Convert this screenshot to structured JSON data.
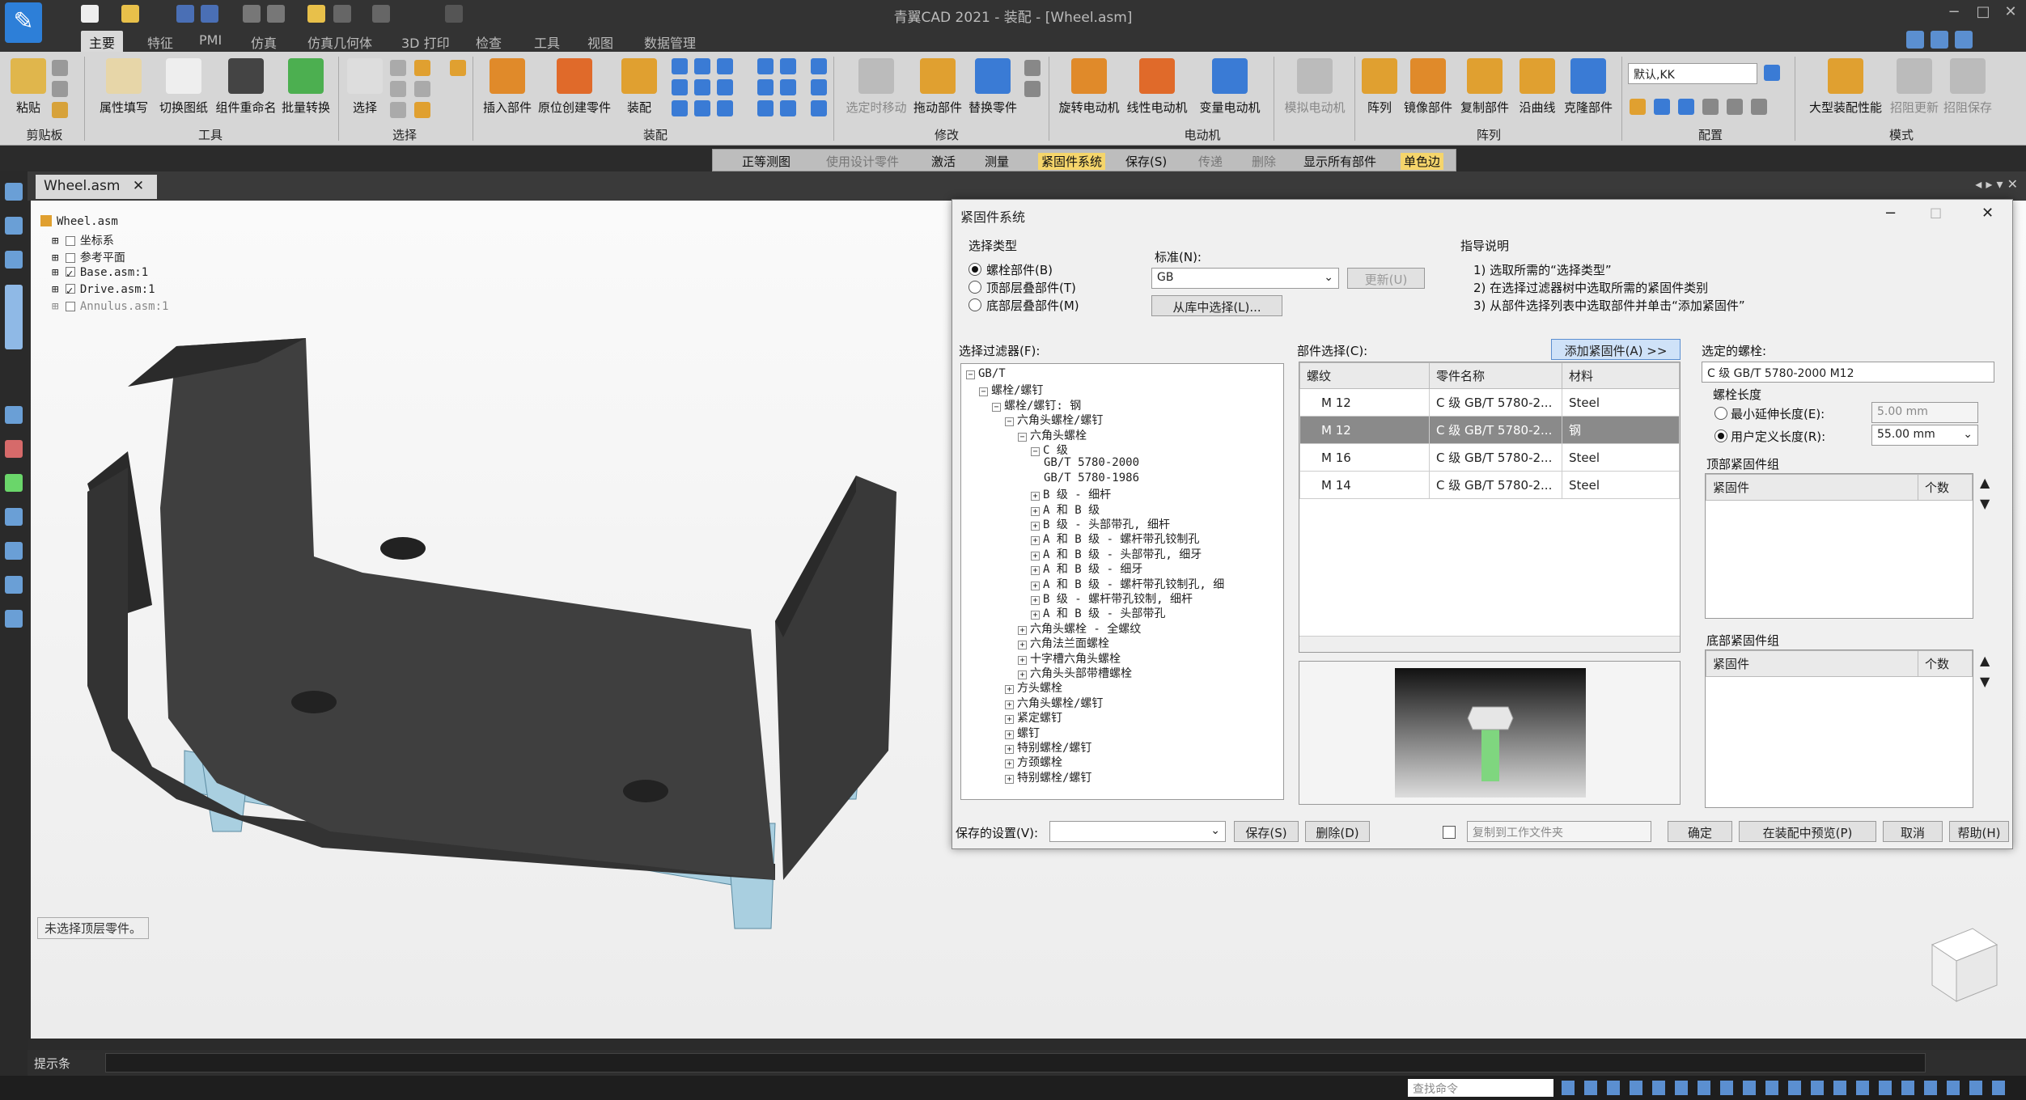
{
  "window": {
    "title": "青翼CAD 2021 - 装配 - [Wheel.asm]"
  },
  "menu_tabs": [
    "主要",
    "特征",
    "PMI",
    "仿真",
    "仿真几何体",
    "3D 打印",
    "检查",
    "工具",
    "视图",
    "数据管理"
  ],
  "active_tab": "主要",
  "ribbon": {
    "buttons": [
      "粘贴",
      "属性填写",
      "切换图纸",
      "组件重命名",
      "批量转换",
      "选择",
      "插入部件",
      "原位创建零件",
      "装配",
      "选定时移动",
      "拖动部件",
      "替换零件",
      "旋转电动机",
      "线性电动机",
      "变量电动机",
      "模拟电动机",
      "阵列",
      "镜像部件",
      "复制部件",
      "沿曲线",
      "克隆部件",
      "大型装配性能",
      "招阻更新",
      "招阻保存"
    ],
    "groups": [
      "剪贴板",
      "工具",
      "选择",
      "装配",
      "修改",
      "电动机",
      "阵列",
      "配置",
      "模式"
    ],
    "config_value": "默认,KK"
  },
  "quick_toolbar": {
    "items": [
      "正等测图",
      "使用设计零件",
      "激活",
      "测量",
      "紧固件系统",
      "保存(S)",
      "传递",
      "删除",
      "显示所有部件",
      "单色边"
    ]
  },
  "doc_tab": "Wheel.asm",
  "assembly_tree": [
    {
      "label": "Wheel.asm",
      "checked": null
    },
    {
      "label": "坐标系",
      "checked": false
    },
    {
      "label": "参考平面",
      "checked": false
    },
    {
      "label": "Base.asm:1",
      "checked": true
    },
    {
      "label": "Drive.asm:1",
      "checked": true
    },
    {
      "label": "Annulus.asm:1",
      "checked": false
    }
  ],
  "viewport_status": "未选择顶层零件。",
  "dialog": {
    "title": "紧固件系统",
    "select_type": {
      "label": "选择类型",
      "options": [
        "螺栓部件(B)",
        "顶部层叠部件(T)",
        "底部层叠部件(M)"
      ],
      "selected": 0
    },
    "standard": {
      "label": "标准(N):",
      "value": "GB",
      "update_button": "更新(U)",
      "library_button": "从库中选择(L)..."
    },
    "guide": {
      "title": "指导说明",
      "steps": [
        "1) 选取所需的“选择类型”",
        "2) 在选择过滤器树中选取所需的紧固件类别",
        "3) 从部件选择列表中选取部件并单击“添加紧固件”"
      ]
    },
    "filter": {
      "label": "选择过滤器(F):",
      "tree": [
        {
          "d": 0,
          "pm": "−",
          "t": "GB/T"
        },
        {
          "d": 1,
          "pm": "−",
          "t": "螺栓/螺钉"
        },
        {
          "d": 2,
          "pm": "−",
          "t": "螺栓/螺钉: 钢"
        },
        {
          "d": 3,
          "pm": "−",
          "t": "六角头螺栓/螺钉"
        },
        {
          "d": 4,
          "pm": "−",
          "t": "六角头螺栓"
        },
        {
          "d": 5,
          "pm": "−",
          "t": "C 级"
        },
        {
          "d": 6,
          "pm": "",
          "t": "GB/T 5780-2000"
        },
        {
          "d": 6,
          "pm": "",
          "t": "GB/T 5780-1986"
        },
        {
          "d": 5,
          "pm": "+",
          "t": "B 级 - 细杆"
        },
        {
          "d": 5,
          "pm": "+",
          "t": "A 和 B 级"
        },
        {
          "d": 5,
          "pm": "+",
          "t": "B 级 - 头部带孔, 细杆"
        },
        {
          "d": 5,
          "pm": "+",
          "t": "A 和 B 级 - 螺杆带孔铰制孔"
        },
        {
          "d": 5,
          "pm": "+",
          "t": "A 和 B 级 - 头部带孔, 细牙"
        },
        {
          "d": 5,
          "pm": "+",
          "t": "A 和 B 级 - 细牙"
        },
        {
          "d": 5,
          "pm": "+",
          "t": "A 和 B 级 - 螺杆带孔铰制孔, 细"
        },
        {
          "d": 5,
          "pm": "+",
          "t": "B 级 - 螺杆带孔铰制, 细杆"
        },
        {
          "d": 5,
          "pm": "+",
          "t": "A 和 B 级 - 头部带孔"
        },
        {
          "d": 4,
          "pm": "+",
          "t": "六角头螺栓 - 全螺纹"
        },
        {
          "d": 4,
          "pm": "+",
          "t": "六角法兰面螺栓"
        },
        {
          "d": 4,
          "pm": "+",
          "t": "十字槽六角头螺栓"
        },
        {
          "d": 4,
          "pm": "+",
          "t": "六角头头部带槽螺栓"
        },
        {
          "d": 3,
          "pm": "+",
          "t": "方头螺栓"
        },
        {
          "d": 3,
          "pm": "+",
          "t": "六角头螺栓/螺钉"
        },
        {
          "d": 3,
          "pm": "+",
          "t": "紧定螺钉"
        },
        {
          "d": 3,
          "pm": "+",
          "t": "螺钉"
        },
        {
          "d": 3,
          "pm": "+",
          "t": "特别螺栓/螺钉"
        },
        {
          "d": 3,
          "pm": "+",
          "t": "方颈螺栓"
        },
        {
          "d": 3,
          "pm": "+",
          "t": "特别螺栓/螺钉"
        }
      ]
    },
    "part_select": {
      "label": "部件选择(C):",
      "add_button": "添加紧固件(A) >>",
      "headers": [
        "螺纹",
        "零件名称",
        "材料"
      ],
      "rows": [
        [
          "M 12",
          "C 级 GB/T 5780-2...",
          "Steel"
        ],
        [
          "M 12",
          "C 级 GB/T 5780-2...",
          "钢"
        ],
        [
          "M 16",
          "C 级 GB/T 5780-2...",
          "Steel"
        ],
        [
          "M 14",
          "C 级 GB/T 5780-2...",
          "Steel"
        ]
      ],
      "selected_row": 1
    },
    "selected_bolt": {
      "label": "选定的螺栓:",
      "value": "C 级 GB/T 5780-2000 M12"
    },
    "bolt_length": {
      "label": "螺栓长度",
      "min_label": "最小延伸长度(E):",
      "min_value": "5.00 mm",
      "user_label": "用户定义长度(R):",
      "user_value": "55.00 mm",
      "selected": 1
    },
    "top_group": {
      "label": "顶部紧固件组",
      "headers": [
        "紧固件",
        "个数"
      ]
    },
    "bottom_group": {
      "label": "底部紧固件组",
      "headers": [
        "紧固件",
        "个数"
      ]
    },
    "saved_settings_label": "保存的设置(V):",
    "save_button": "保存(S)",
    "delete_button": "删除(D)",
    "copy_label": "复制到工作文件夹",
    "ok_button": "确定",
    "preview_button": "在装配中预览(P)",
    "cancel_button": "取消",
    "help_button": "帮助(H)"
  },
  "prompt_bar": {
    "label": "提示条"
  },
  "status_bar": {
    "search_placeholder": "查找命令"
  },
  "colors": {
    "accent": "#f5d56b",
    "part_dark": "#3a3a3a",
    "part_blue": "#a9cfe0",
    "bolt_green": "#7fd67f"
  }
}
